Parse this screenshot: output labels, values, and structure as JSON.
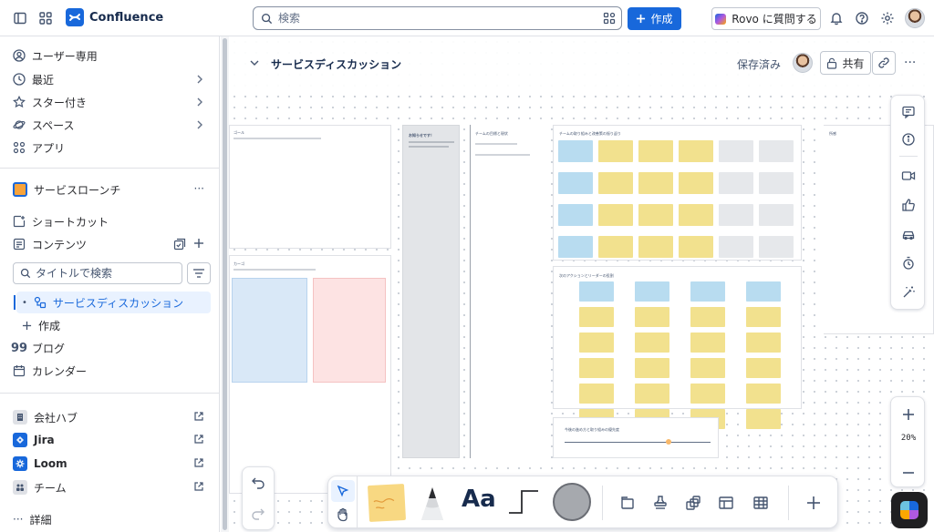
{
  "header": {
    "app_name": "Confluence",
    "search_placeholder": "検索",
    "create_label": "作成",
    "rovo_label": "Rovo に質問する"
  },
  "sidebar": {
    "items": [
      {
        "label": "ユーザー専用"
      },
      {
        "label": "最近"
      },
      {
        "label": "スター付き"
      },
      {
        "label": "スペース"
      },
      {
        "label": "アプリ"
      }
    ],
    "space": {
      "name": "サービスローンチ",
      "more": "···"
    },
    "space_items": [
      {
        "label": "ショートカット"
      },
      {
        "label": "コンテンツ"
      }
    ],
    "tree_search_placeholder": "タイトルで検索",
    "tree": [
      {
        "label": "サービスディスカッション",
        "bullet": "•"
      },
      {
        "label": "作成"
      }
    ],
    "more_items": [
      {
        "label": "ブログ"
      },
      {
        "label": "カレンダー"
      }
    ],
    "apps": [
      {
        "label": "会社ハブ",
        "color": "#44546f"
      },
      {
        "label": "Jira",
        "color": "#1868db"
      },
      {
        "label": "Loom",
        "color": "#1868db"
      },
      {
        "label": "チーム",
        "color": "#44546f"
      }
    ],
    "details_label": "詳細",
    "details_dots": "···"
  },
  "page": {
    "title": "サービスディスカッション",
    "status": "保存済み",
    "share_label": "共有",
    "more": "···"
  },
  "board": {
    "frame_titles": {
      "left_top": "ゴール",
      "left_bottom": "カーゴ",
      "card_title": "お知らせです！",
      "mid_title": "チームの目標と現状",
      "grid_title": "チームの取り組みと改善策の振り返り",
      "grid2_title": "次のアクションとリーダーの役割",
      "timeline_title": "今後の進め方と取り組みの優先度",
      "right_title": "所感"
    }
  },
  "zoom": {
    "level": "20%"
  },
  "colors": {
    "accent": "#1868db",
    "sticky_blue": "#b8dcf0",
    "sticky_yellow": "#f2e18e",
    "sticky_gray": "#e6e8eb",
    "sticky_pink": "#fde3e3"
  }
}
